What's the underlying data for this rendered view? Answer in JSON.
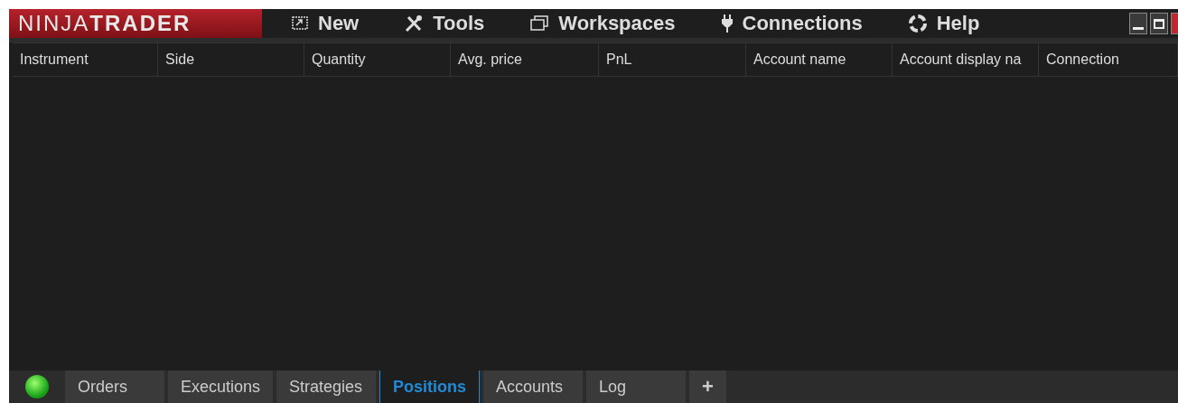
{
  "logo": {
    "part_1": "NINJA",
    "part_2": "TRADER"
  },
  "menu": [
    {
      "label": "New",
      "kind": "new"
    },
    {
      "label": "Tools",
      "kind": "tools"
    },
    {
      "label": "Workspaces",
      "kind": "workspaces"
    },
    {
      "label": "Connections",
      "kind": "connections"
    },
    {
      "label": "Help",
      "kind": "help"
    }
  ],
  "table": {
    "columns": [
      "Instrument",
      "Side",
      "Quantity",
      "Avg. price",
      "PnL",
      "Account name",
      "Account display na",
      "Connection"
    ]
  },
  "tabs": [
    {
      "label": "Orders",
      "selected": false
    },
    {
      "label": "Executions",
      "selected": false
    },
    {
      "label": "Strategies",
      "selected": false
    },
    {
      "label": "Positions",
      "selected": true
    },
    {
      "label": "Accounts",
      "selected": false
    },
    {
      "label": "Log",
      "selected": false
    }
  ],
  "add_tab": "+"
}
